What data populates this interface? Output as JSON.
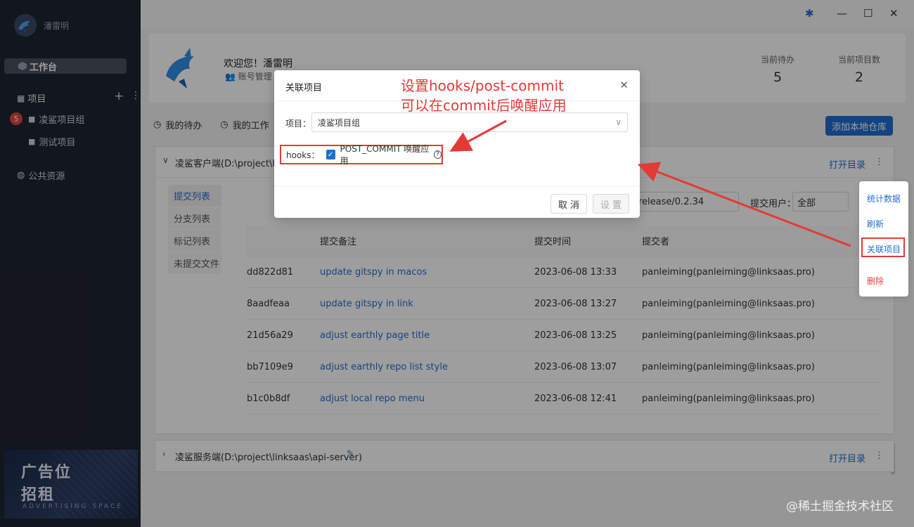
{
  "sidebar": {
    "username": "潘雷明",
    "workbench": "工作台",
    "projects_label": "项目",
    "badge": "5",
    "items": [
      {
        "label": "凌鲨项目组"
      },
      {
        "label": "测试项目"
      }
    ],
    "public_resources": "公共资源",
    "ad": {
      "line1": "广告位",
      "line2": "招租",
      "line3": "ADVERTISING SPACE"
    }
  },
  "welcome": {
    "hello": "欢迎您！潘雷明",
    "account": "账号管理",
    "stats": [
      {
        "label": "当前待办",
        "value": "5"
      },
      {
        "label": "当前项目数",
        "value": "2"
      }
    ]
  },
  "tabs": {
    "todo": "我的待办",
    "work": "我的工作"
  },
  "add_repo": "添加本地仓库",
  "repo1": {
    "title": "凌鲨客户端(D:\\project\\links",
    "open_dir": "打开目录",
    "side_tabs": [
      "提交列表",
      "分支列表",
      "标记列表",
      "未提交文件"
    ],
    "branch_value": "release/0.2.34",
    "user_label": "提交用户：",
    "user_value": "全部",
    "columns": [
      "提交备注",
      "提交时间",
      "提交者"
    ],
    "rows": [
      {
        "hash": "dd822d81",
        "msg": "update gitspy in macos",
        "time": "2023-06-08 13:33",
        "author": "panleiming(panleiming@linksaas.pro)"
      },
      {
        "hash": "8aadfeaa",
        "msg": "update gitspy in link",
        "time": "2023-06-08 13:27",
        "author": "panleiming(panleiming@linksaas.pro)"
      },
      {
        "hash": "21d56a29",
        "msg": "adjust earthly page title",
        "time": "2023-06-08 13:25",
        "author": "panleiming(panleiming@linksaas.pro)"
      },
      {
        "hash": "bb7109e9",
        "msg": "adjust earthly repo list style",
        "time": "2023-06-08 13:07",
        "author": "panleiming(panleiming@linksaas.pro)"
      },
      {
        "hash": "b1c0b8df",
        "msg": "adjust local repo menu",
        "time": "2023-06-08 12:41",
        "author": "panleiming(panleiming@linksaas.pro)"
      }
    ]
  },
  "repo2": {
    "title": "凌鲨服务端(D:\\project\\linksaas\\api-server)",
    "open_dir": "打开目录"
  },
  "context_menu": {
    "stats": "统计数据",
    "refresh": "刷新",
    "link_project": "关联项目",
    "delete": "删除"
  },
  "modal": {
    "title": "关联项目",
    "project_label": "项目：",
    "project_value": "凌鲨项目组",
    "hooks_label": "hooks：",
    "hook_option": "POST_COMMIT 唤醒应用",
    "help": "?",
    "cancel": "取 消",
    "confirm": "设 置"
  },
  "annotation": {
    "line1": "设置hooks/post-commit",
    "line2": "可以在commit后唤醒应用"
  },
  "watermark": "@稀土掘金技术社区",
  "colors": {
    "accent": "#1f6fd1",
    "annotation": "#e53935",
    "sidebar": "#1e2430"
  }
}
